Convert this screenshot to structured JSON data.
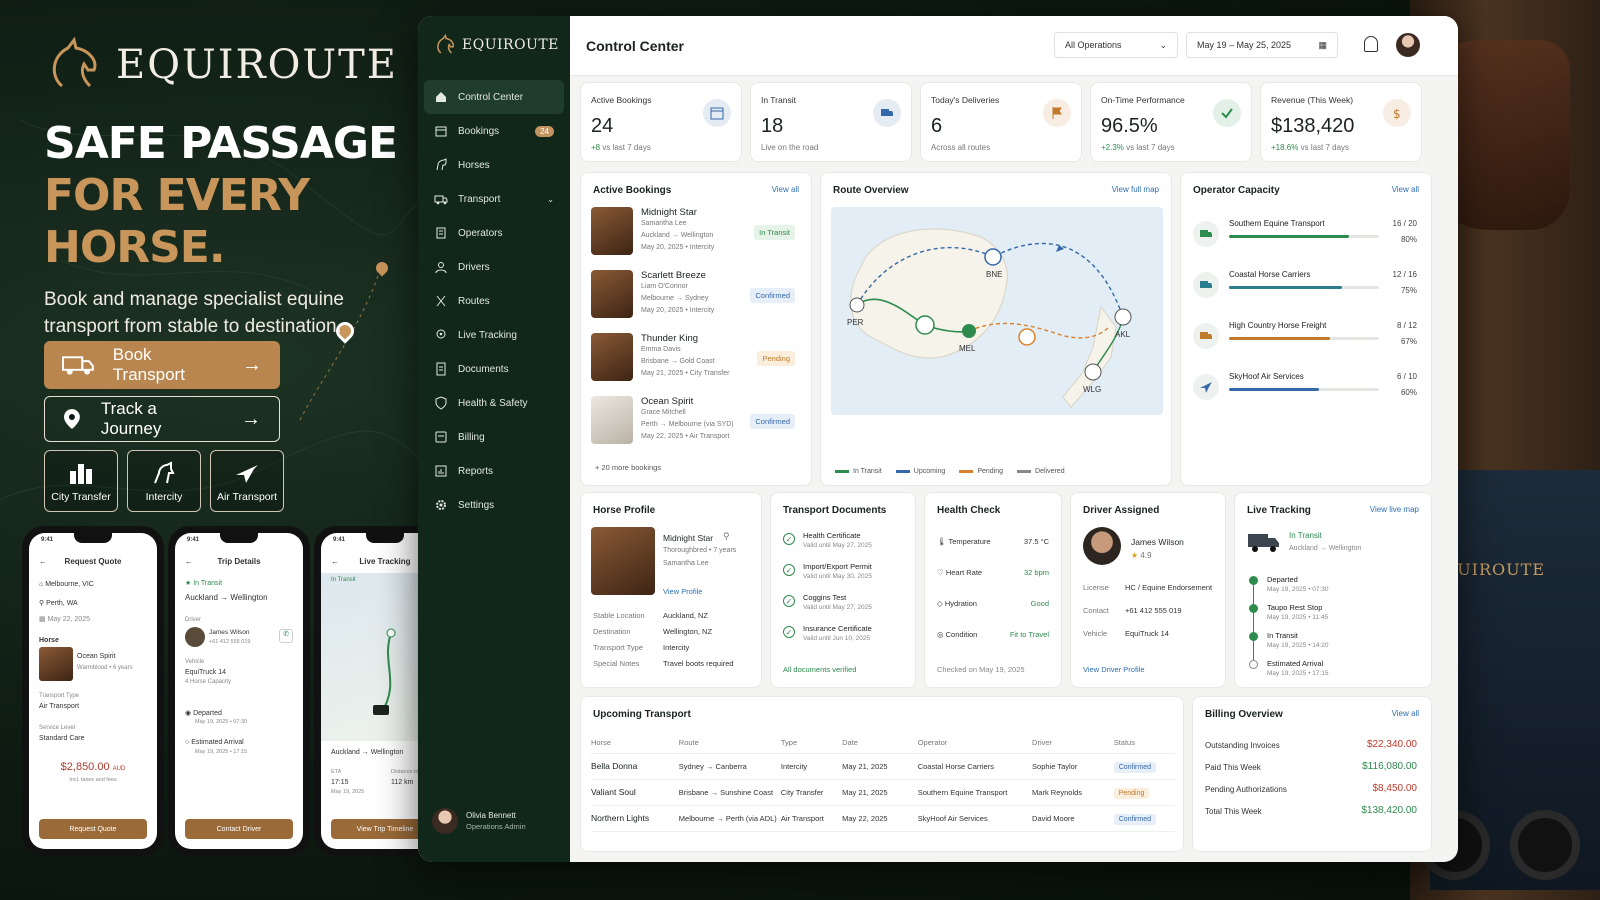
{
  "brand": {
    "name": "EQUIROUTE"
  },
  "hero": {
    "headline_1": "SAFE PASSAGE",
    "headline_2": "FOR EVERY HORSE.",
    "lead": "Book and manage specialist equine transport from stable to destination.",
    "book_label": "Book Transport",
    "track_label": "Track a Journey",
    "tiles": [
      "City Transfer",
      "Intercity",
      "Air Transport"
    ]
  },
  "phones": {
    "quote": {
      "time": "9:41",
      "title": "Request Quote",
      "from": "Melbourne, VIC",
      "to": "Perth, WA",
      "date": "May 22, 2025",
      "horse_label": "Horse",
      "horse_name": "Ocean Spirit",
      "horse_sub": "Warmblood • 6 years",
      "type_label": "Transport Type",
      "type_value": "Air Transport",
      "level_label": "Service Level",
      "level_value": "Standard Care",
      "price": "$2,850.00",
      "price_unit": "AUD",
      "price_note": "Incl. taxes and fees",
      "button": "Request Quote"
    },
    "trip": {
      "time": "9:41",
      "title": "Trip Details",
      "status": "In Transit",
      "route_from": "Auckland",
      "route_to": "Wellington",
      "driver_label": "Driver",
      "driver_name": "James Wilson",
      "driver_phone": "+61 412 555 019",
      "vehicle_label": "Vehicle",
      "vehicle_name": "EquiTruck 14",
      "vehicle_cap": "4 Horse Capacity",
      "dep_label": "Departed",
      "dep_time": "May 19, 2025 • 07:30",
      "arr_label": "Estimated Arrival",
      "arr_time": "May 19, 2025 • 17:15",
      "button": "Contact Driver"
    },
    "live": {
      "time": "9:41",
      "title": "Live Tracking",
      "status": "In Transit",
      "route_from": "Auckland",
      "route_to": "Wellington",
      "eta_label": "ETA",
      "eta": "17:15",
      "eta_date": "May 19, 2025",
      "dist_label": "Distance to Go",
      "dist": "112 km",
      "button": "View Trip Timeline"
    }
  },
  "sidebar": {
    "brand": "EQUIROUTE",
    "items": [
      {
        "label": "Control Center",
        "icon": "home-icon"
      },
      {
        "label": "Bookings",
        "icon": "calendar-icon",
        "badge": "24"
      },
      {
        "label": "Horses",
        "icon": "horse-icon"
      },
      {
        "label": "Transport",
        "icon": "truck-icon"
      },
      {
        "label": "Operators",
        "icon": "building-icon"
      },
      {
        "label": "Drivers",
        "icon": "user-icon"
      },
      {
        "label": "Routes",
        "icon": "route-icon"
      },
      {
        "label": "Live Tracking",
        "icon": "pin-icon"
      },
      {
        "label": "Documents",
        "icon": "document-icon"
      },
      {
        "label": "Health & Safety",
        "icon": "shield-icon"
      },
      {
        "label": "Billing",
        "icon": "billing-icon"
      },
      {
        "label": "Reports",
        "icon": "reports-icon"
      },
      {
        "label": "Settings",
        "icon": "gear-icon"
      }
    ],
    "user_name": "Olivia Bennett",
    "user_role": "Operations Admin"
  },
  "topbar": {
    "title": "Control Center",
    "filter": "All Operations",
    "date_range": "May 19 – May 25, 2025"
  },
  "kpis": [
    {
      "label": "Active Bookings",
      "value": "24",
      "delta": "+8",
      "sub": "vs last 7 days",
      "color": "#3568a8"
    },
    {
      "label": "In Transit",
      "value": "18",
      "delta": "",
      "sub": "Live on the road",
      "color": "#3568a8"
    },
    {
      "label": "Today's Deliveries",
      "value": "6",
      "delta": "",
      "sub": "Across all routes",
      "color": "#c07a2c"
    },
    {
      "label": "On-Time Performance",
      "value": "96.5%",
      "delta": "+2.3%",
      "sub": "vs last 7 days",
      "color": "#2e8b4e"
    },
    {
      "label": "Revenue (This Week)",
      "value": "$138,420",
      "delta": "+18.6%",
      "sub": "vs last 7 days",
      "color": "#c07a2c"
    }
  ],
  "active_bookings": {
    "title": "Active Bookings",
    "link": "View all",
    "more": "20 more bookings",
    "items": [
      {
        "name": "Midnight Star",
        "owner": "Samantha Lee",
        "from": "Auckland",
        "to": "Wellington",
        "meta": "May 20, 2025 • Intercity",
        "status": "In Transit",
        "tone": "green"
      },
      {
        "name": "Scarlett Breeze",
        "owner": "Liam O'Connor",
        "from": "Melbourne",
        "to": "Sydney",
        "meta": "May 20, 2025 • Intercity",
        "status": "Confirmed",
        "tone": "blue"
      },
      {
        "name": "Thunder King",
        "owner": "Emma Davis",
        "from": "Brisbane",
        "to": "Gold Coast",
        "meta": "May 21, 2025 • City Transfer",
        "status": "Pending",
        "tone": "amber"
      },
      {
        "name": "Ocean Spirit",
        "owner": "Grace Mitchell",
        "from": "Perth",
        "to": "Melbourne (via SYD)",
        "meta": "May 22, 2025 • Air Transport",
        "status": "Confirmed",
        "tone": "blue"
      }
    ]
  },
  "route_overview": {
    "title": "Route Overview",
    "link": "View full map",
    "cities": [
      "BNE",
      "PER",
      "MEL",
      "AKL",
      "WLG"
    ],
    "legend": [
      "In Transit",
      "Upcoming",
      "Pending",
      "Delivered"
    ]
  },
  "operator_capacity": {
    "title": "Operator Capacity",
    "link": "View all",
    "items": [
      {
        "name": "Southern Equine Transport",
        "count": "16 / 20",
        "pct": "80%",
        "fill": 0.8,
        "color": "#2e8b4e"
      },
      {
        "name": "Coastal Horse Carriers",
        "count": "12 / 16",
        "pct": "75%",
        "fill": 0.75,
        "color": "#2a7d8c"
      },
      {
        "name": "High Country Horse Freight",
        "count": "8 / 12",
        "pct": "67%",
        "fill": 0.67,
        "color": "#c07a2c"
      },
      {
        "name": "SkyHoof Air Services",
        "count": "6 / 10",
        "pct": "60%",
        "fill": 0.6,
        "color": "#3568a8"
      }
    ]
  },
  "horse_profile": {
    "title": "Horse Profile",
    "name": "Midnight Star",
    "breed": "Thoroughbred • 7 years",
    "owner": "Samantha Lee",
    "link": "View Profile",
    "fields": [
      {
        "k": "Stable Location",
        "v": "Auckland, NZ"
      },
      {
        "k": "Destination",
        "v": "Wellington, NZ"
      },
      {
        "k": "Transport Type",
        "v": "Intercity"
      },
      {
        "k": "Special Notes",
        "v": "Travel boots required"
      }
    ]
  },
  "documents": {
    "title": "Transport Documents",
    "footer": "All documents verified",
    "items": [
      {
        "t": "Health Certificate",
        "s": "Valid until May 27, 2025"
      },
      {
        "t": "Import/Export Permit",
        "s": "Valid until May 30, 2025"
      },
      {
        "t": "Coggins Test",
        "s": "Valid until May 27, 2025"
      },
      {
        "t": "Insurance Certificate",
        "s": "Valid until Jun 10, 2025"
      }
    ]
  },
  "health": {
    "title": "Health Check",
    "footer": "Checked on May 19, 2025",
    "items": [
      {
        "k": "Temperature",
        "v": "37.5 °C"
      },
      {
        "k": "Heart Rate",
        "v": "32 bpm"
      },
      {
        "k": "Hydration",
        "v": "Good"
      },
      {
        "k": "Condition",
        "v": "Fit to Travel"
      }
    ]
  },
  "driver": {
    "title": "Driver Assigned",
    "name": "James Wilson",
    "rating": "4.9",
    "link": "View Driver Profile",
    "fields": [
      {
        "k": "License",
        "v": "HC / Equine Endorsement"
      },
      {
        "k": "Contact",
        "v": "+61 412 555 019"
      },
      {
        "k": "Vehicle",
        "v": "EquiTruck 14"
      }
    ]
  },
  "live_tracking": {
    "title": "Live Tracking",
    "link": "View live map",
    "status": "In Transit",
    "from": "Auckland",
    "to": "Wellington",
    "steps": [
      {
        "t": "Departed",
        "s": "May 19, 2025 • 07:30"
      },
      {
        "t": "Taupo Rest Stop",
        "s": "May 19, 2025 • 11:45"
      },
      {
        "t": "In Transit",
        "s": "May 19, 2025 • 14:20"
      },
      {
        "t": "Estimated Arrival",
        "s": "May 19, 2025 • 17:15"
      }
    ]
  },
  "upcoming": {
    "title": "Upcoming Transport",
    "headers": [
      "Horse",
      "Route",
      "Type",
      "Date",
      "Operator",
      "Driver",
      "Status"
    ],
    "rows": [
      {
        "horse": "Bella Donna",
        "from": "Sydney",
        "to": "Canberra",
        "type": "Intercity",
        "date": "May 21, 2025",
        "operator": "Coastal Horse Carriers",
        "driver": "Sophie Taylor",
        "status": "Confirmed",
        "tone": "blue"
      },
      {
        "horse": "Valiant Soul",
        "from": "Brisbane",
        "to": "Sunshine Coast",
        "type": "City Transfer",
        "date": "May 21, 2025",
        "operator": "Southern Equine Transport",
        "driver": "Mark Reynolds",
        "status": "Pending",
        "tone": "amber"
      },
      {
        "horse": "Northern Lights",
        "from": "Melbourne",
        "to": "Perth (via ADL)",
        "type": "Air Transport",
        "date": "May 22, 2025",
        "operator": "SkyHoof Air Services",
        "driver": "David Moore",
        "status": "Confirmed",
        "tone": "blue"
      }
    ]
  },
  "billing": {
    "title": "Billing Overview",
    "link": "View all",
    "items": [
      {
        "k": "Outstanding Invoices",
        "v": "$22,340.00",
        "color": "#c0392b"
      },
      {
        "k": "Paid This Week",
        "v": "$116,080.00",
        "color": "#2e8b4e"
      },
      {
        "k": "Pending Authorizations",
        "v": "$8,450.00",
        "color": "#c0392b"
      },
      {
        "k": "Total This Week",
        "v": "$138,420.00",
        "color": "#2e8b4e"
      }
    ]
  },
  "truck_brand": "EQUIROUTE"
}
